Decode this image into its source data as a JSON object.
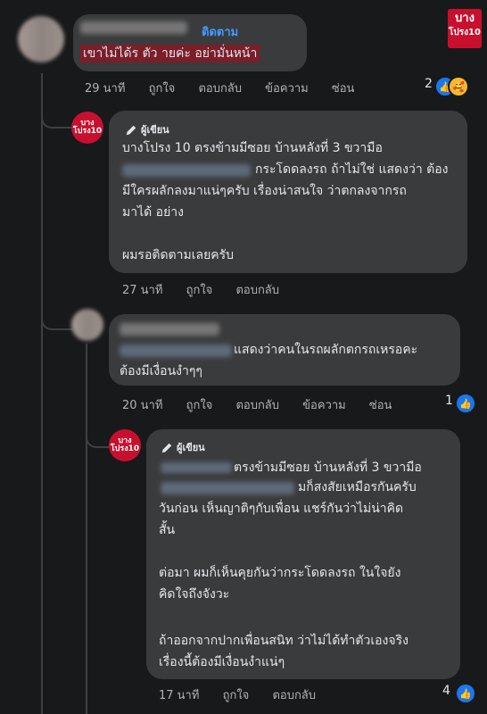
{
  "brand": {
    "logo_line1": "บาง",
    "logo_line2": "โปรง10"
  },
  "comment1": {
    "name_blur": "",
    "follow": "ติดตาม",
    "text": "เขาไม่ได้ร    ตัว   ายค่ะ อย่ามั่นหน้า",
    "time": "29 นาที",
    "like": "ถูกใจ",
    "reply": "ตอบกลับ",
    "message": "ข้อความ",
    "hide": "ซ่อน",
    "reaction_count": "2"
  },
  "reply1": {
    "author_badge": "ผู้เขียน",
    "lines": [
      "บางโปรง 10 ตรงข้ามมีซอย บ้านหลังที่ 3 ขวามือ",
      "กระโดดลงรถ ถ้าไม่ใช่ แสดงว่า ต้อง",
      "มีใครผลักลงมาแน่ๆครับ เรื่องน่าสนใจ ว่าตกลงจากรถ",
      "มาได้ อย่าง",
      "ผมรอติดตามเลยครับ"
    ],
    "time": "27 นาที",
    "like": "ถูกใจ",
    "reply": "ตอบกลับ"
  },
  "comment2": {
    "lines": [
      "แสดงว่าคนในรถผลักตกรถเหรอคะ",
      "ต้องมีเงื่อนงำๆๆ"
    ],
    "time": "20 นาที",
    "like": "ถูกใจ",
    "reply": "ตอบกลับ",
    "message": "ข้อความ",
    "hide": "ซ่อน",
    "reaction_count": "1"
  },
  "reply2": {
    "author_badge": "ผู้เขียน",
    "lines": [
      "ตรงข้ามมีซอย บ้านหลังที่ 3 ขวามือ",
      "มก็สงสัยเหมือรกันครับ",
      "วันก่อน เห็นญาติๆกับเพื่อน แชร์กันว่าไม่น่าคิด",
      "สั้น",
      "ต่อมา ผมก็เห็นคุยกันว่ากระโดดลงรถ ในใจยัง",
      "คิดใจถึงจังวะ",
      "ถ้าออกจากปากเพื่อนสนิท ว่าไม่ได้ทำตัวเองจริง",
      "เรื่องนี้ต้องมีเงื่อนงำแน่ๆ"
    ],
    "time": "17 นาที",
    "like": "ถูกใจ",
    "reply": "ตอบกลับ",
    "reaction_count": "4"
  },
  "colors": {
    "background": "#18191a",
    "bubble": "#3a3b3c",
    "like_blue": "#1877f2",
    "brand_red": "#c8102e"
  }
}
